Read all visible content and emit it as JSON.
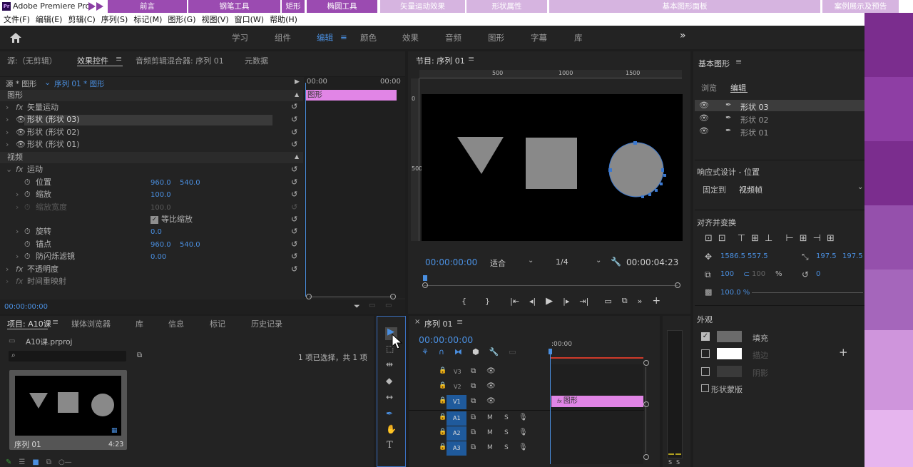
{
  "titlebar": {
    "app": "Adobe Premiere Pro",
    "logo": "Pr"
  },
  "course_tabs": [
    "前言",
    "钢笔工具",
    "矩形",
    "椭圆工具",
    "矢量运动效果",
    "形状属性",
    "基本图形面板",
    "案例展示及预告"
  ],
  "menu": [
    "文件(F)",
    "编辑(E)",
    "剪辑(C)",
    "序列(S)",
    "标记(M)",
    "图形(G)",
    "视图(V)",
    "窗口(W)",
    "帮助(H)"
  ],
  "workspaces": [
    "学习",
    "组件",
    "编辑",
    "颜色",
    "效果",
    "音频",
    "图形",
    "字幕",
    "库"
  ],
  "source_panel": {
    "tabs": [
      "源:（无剪辑）",
      "效果控件",
      "音频剪辑混合器: 序列 01",
      "元数据"
    ]
  },
  "effect_controls": {
    "source": "源 * 图形",
    "sequence": "序列 01 * 图形",
    "time_start": "00:00",
    "time_end": "00:00",
    "clip": "图形",
    "sections": {
      "graphic": "图形",
      "video": "视频"
    },
    "rows": {
      "vector_motion": "矢量运动",
      "shape3": "形状 (形状 03)",
      "shape2": "形状 (形状 02)",
      "shape1": "形状 (形状 01)",
      "motion": "运动",
      "position": "位置",
      "position_x": "960.0",
      "position_y": "540.0",
      "scale": "缩放",
      "scale_val": "100.0",
      "scale_width": "缩放宽度",
      "scale_width_val": "100.0",
      "uniform": "等比缩放",
      "rotation": "旋转",
      "rotation_val": "0.0",
      "anchor": "锚点",
      "anchor_x": "960.0",
      "anchor_y": "540.0",
      "flicker": "防闪烁滤镜",
      "flicker_val": "0.00",
      "opacity": "不透明度",
      "time_remap": "时间重映射"
    },
    "timecode": "00:00:00:00"
  },
  "program": {
    "title": "节目: 序列 01",
    "ruler": [
      "500",
      "1000",
      "1500"
    ],
    "vruler": [
      "0",
      "500"
    ],
    "timecode": "00:00:00:00",
    "fit": "适合",
    "resolution": "1/4",
    "duration": "00:00:04:23"
  },
  "essential_graphics": {
    "title": "基本图形",
    "tabs": [
      "浏览",
      "编辑"
    ],
    "layers": [
      "形状 03",
      "形状 02",
      "形状 01"
    ],
    "responsive": "响应式设计 - 位置",
    "pin_label": "固定到",
    "pin_value": "视频帧",
    "align": "对齐并变换",
    "pos_x": "1586.5",
    "pos_y": "557.5",
    "anchor_x": "197.5",
    "anchor_y": "197.5",
    "scale": "100",
    "scale2": "100",
    "percent": "%",
    "rotation": "0",
    "opacity": "100.0 %",
    "appearance": "外观",
    "fill": "填充",
    "stroke": "描边",
    "shadow": "阴影",
    "mask": "形状蒙版",
    "colors": {
      "fill": "#6b6b6b",
      "stroke": "#ffffff",
      "shadow": "#3a3a3a"
    }
  },
  "project": {
    "tabs": [
      "项目: A10课",
      "媒体浏览器",
      "库",
      "信息",
      "标记",
      "历史记录"
    ],
    "file": "A10课.prproj",
    "selection": "1 项已选择，共 1 项",
    "item": "序列 01",
    "item_dur": "4:23"
  },
  "timeline": {
    "title": "序列 01",
    "timecode": "00:00:00:00",
    "ruler_start": ":00:00",
    "clip": "图形",
    "video_tracks": [
      "V3",
      "V2",
      "V1"
    ],
    "audio_tracks": [
      "A1",
      "A2",
      "A3"
    ],
    "m": "M",
    "s": "S"
  },
  "meters": {
    "labels": [
      "S",
      "S"
    ]
  },
  "colors": {
    "accent": "#4a8fe0",
    "clip": "#e185e6",
    "purple": "#8a3fa0"
  }
}
